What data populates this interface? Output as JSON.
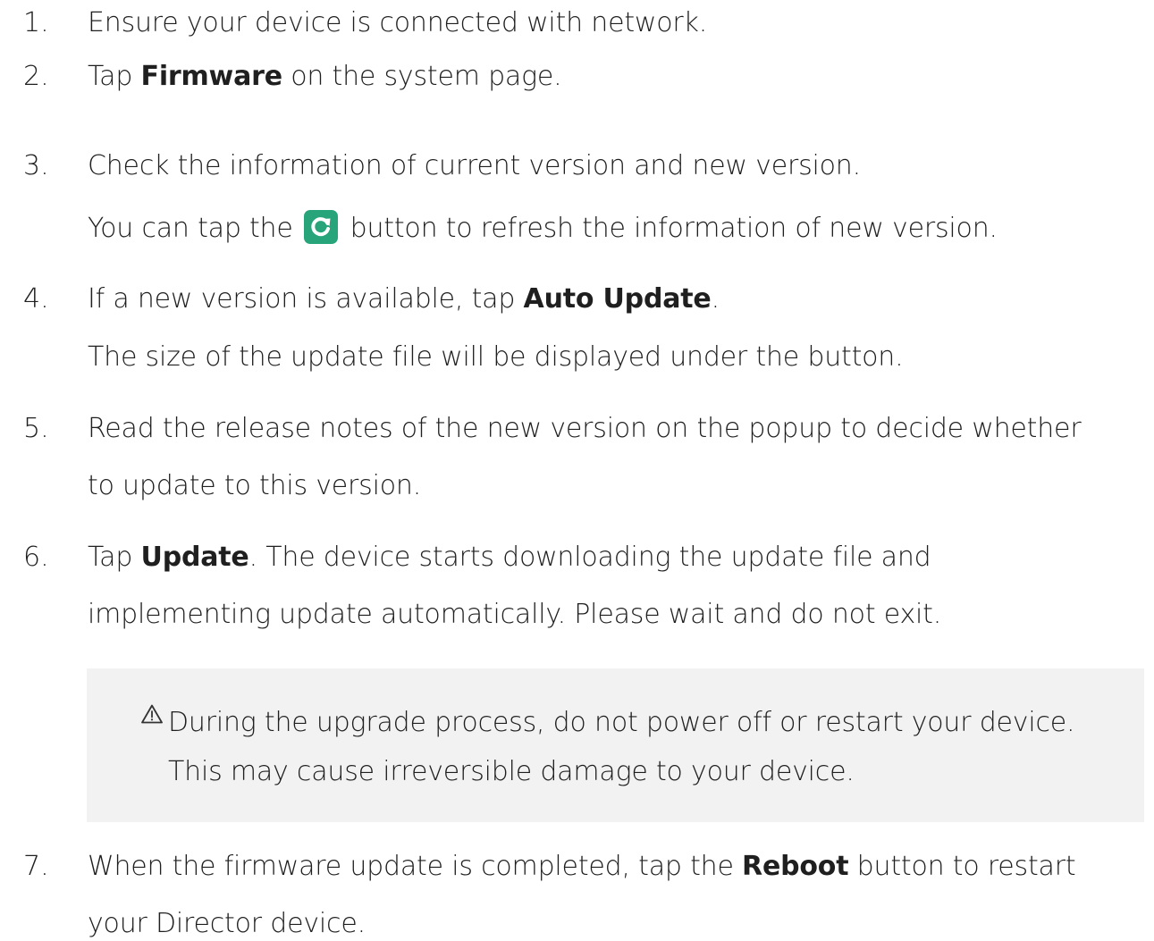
{
  "steps": [
    {
      "num": "1.",
      "lines": [
        {
          "text": "Ensure your device is connected with network."
        }
      ]
    },
    {
      "num": "2.",
      "lines": [
        {
          "pre": "Tap ",
          "bold": "Firmware",
          "post": " on the system page."
        }
      ]
    },
    {
      "num": "3.",
      "lines": [
        {
          "text": "Check the information of current version and new version."
        },
        {
          "pre": "You can tap the",
          "post": "button to refresh the information of new version."
        }
      ]
    },
    {
      "num": "4.",
      "lines": [
        {
          "pre": "If a new version is available, tap ",
          "bold": "Auto Update",
          "post": "."
        },
        {
          "text": "The size of the update file will be displayed under the button."
        }
      ]
    },
    {
      "num": "5.",
      "lines": [
        {
          "text": "Read the release notes of the new version on the popup to decide whether"
        },
        {
          "text": "to update to this version."
        }
      ]
    },
    {
      "num": "6.",
      "lines": [
        {
          "pre": "Tap ",
          "bold": "Update",
          "post": ". The device starts downloading the update file and"
        },
        {
          "text": "implementing update automatically. Please wait and do not exit."
        }
      ]
    },
    {
      "num": "7.",
      "lines": [
        {
          "pre": "When the firmware update is completed, tap the ",
          "bold": "Reboot",
          "post": " button to restart"
        },
        {
          "text": "your Director device."
        }
      ]
    }
  ],
  "warning": {
    "icon": "warning-triangle-icon",
    "line1": "During the upgrade process, do not power off or restart your device.",
    "line2": "This may cause irreversible damage to your device."
  },
  "icons": {
    "refresh": "refresh-icon",
    "refresh_color": "#27a47a"
  }
}
